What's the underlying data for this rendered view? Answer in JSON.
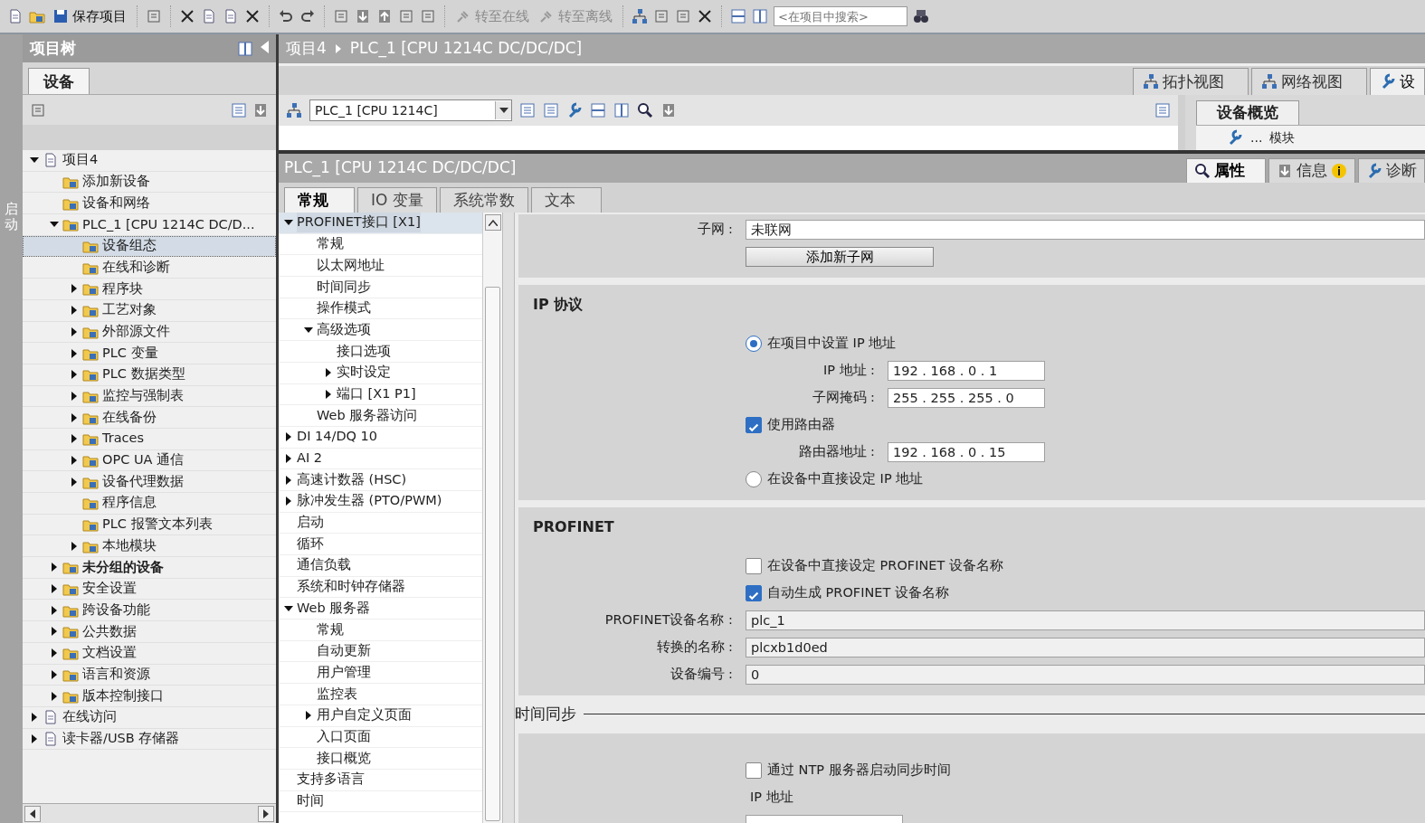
{
  "toolbar": {
    "buttons": [
      {
        "label": "保存项目",
        "disabled": false
      },
      {
        "label": "转至在线",
        "disabled": true
      },
      {
        "label": "转至离线",
        "disabled": true
      }
    ],
    "search": {
      "placeholder": "<在项目中搜索>"
    }
  },
  "side_strip": {
    "label": "启动"
  },
  "project_tree": {
    "title": "项目树",
    "tabs": [
      {
        "label": "设备",
        "selected": true
      }
    ],
    "items": [
      {
        "label": "项目4",
        "expanded": true,
        "selected": false,
        "children": [
          {
            "label": "添加新设备",
            "selected": false
          },
          {
            "label": "设备和网络",
            "selected": false
          },
          {
            "label": "PLC_1 [CPU 1214C DC/D...",
            "expanded": true,
            "selected": false,
            "children": [
              {
                "label": "设备组态",
                "selected": true
              },
              {
                "label": "在线和诊断",
                "selected": false
              },
              {
                "label": "程序块",
                "expanded": false,
                "selected": false
              },
              {
                "label": "工艺对象",
                "expanded": false,
                "selected": false
              },
              {
                "label": "外部源文件",
                "expanded": false,
                "selected": false
              },
              {
                "label": "PLC 变量",
                "expanded": false,
                "selected": false
              },
              {
                "label": "PLC 数据类型",
                "expanded": false,
                "selected": false
              },
              {
                "label": "监控与强制表",
                "expanded": false,
                "selected": false
              },
              {
                "label": "在线备份",
                "expanded": false,
                "selected": false
              },
              {
                "label": "Traces",
                "expanded": false,
                "selected": false
              },
              {
                "label": "OPC UA 通信",
                "expanded": false,
                "selected": false
              },
              {
                "label": "设备代理数据",
                "expanded": false,
                "selected": false
              },
              {
                "label": "程序信息",
                "selected": false
              },
              {
                "label": "PLC 报警文本列表",
                "selected": false
              },
              {
                "label": "本地模块",
                "expanded": false,
                "selected": false
              }
            ]
          },
          {
            "label": "未分组的设备",
            "expanded": false,
            "selected": false,
            "bold": true
          },
          {
            "label": "安全设置",
            "expanded": false,
            "selected": false
          },
          {
            "label": "跨设备功能",
            "expanded": false,
            "selected": false
          },
          {
            "label": "公共数据",
            "expanded": false,
            "selected": false
          },
          {
            "label": "文档设置",
            "expanded": false,
            "selected": false
          },
          {
            "label": "语言和资源",
            "expanded": false,
            "selected": false
          },
          {
            "label": "版本控制接口",
            "expanded": false,
            "selected": false
          }
        ]
      },
      {
        "label": "在线访问",
        "expanded": false,
        "selected": false
      },
      {
        "label": "读卡器/USB 存储器",
        "expanded": false,
        "selected": false
      }
    ]
  },
  "breadcrumb": [
    "项目4",
    "PLC_1 [CPU 1214C DC/DC/DC]"
  ],
  "view_tabs": [
    {
      "label": "拓扑视图",
      "selected": false
    },
    {
      "label": "网络视图",
      "selected": false
    },
    {
      "label": "设",
      "selected": true
    }
  ],
  "device_selector": {
    "value": "PLC_1 [CPU 1214C]"
  },
  "device_overview": {
    "tab": "设备概览",
    "columns": [
      "...",
      "模块"
    ]
  },
  "properties": {
    "title": "PLC_1 [CPU 1214C DC/DC/DC]",
    "side_tabs": [
      {
        "label": "属性",
        "selected": true
      },
      {
        "label": "信息",
        "selected": false
      },
      {
        "label": "诊断",
        "selected": false
      }
    ],
    "tabs": [
      {
        "label": "常规",
        "selected": true
      },
      {
        "label": "IO 变量",
        "selected": false
      },
      {
        "label": "系统常数",
        "selected": false
      },
      {
        "label": "文本",
        "selected": false
      }
    ],
    "nav": [
      {
        "label": "PROFINET接口 [X1]",
        "expanded": true,
        "selected": true,
        "children": [
          {
            "label": "常规",
            "selected": false
          },
          {
            "label": "以太网地址",
            "selected": false
          },
          {
            "label": "时间同步",
            "selected": false
          },
          {
            "label": "操作模式",
            "selected": false
          },
          {
            "label": "高级选项",
            "expanded": true,
            "selected": false,
            "children": [
              {
                "label": "接口选项",
                "selected": false
              },
              {
                "label": "实时设定",
                "expanded": false,
                "selected": false
              },
              {
                "label": "端口 [X1 P1]",
                "expanded": false,
                "selected": false
              }
            ]
          },
          {
            "label": "Web 服务器访问",
            "selected": false
          }
        ]
      },
      {
        "label": "DI 14/DQ 10",
        "expanded": false,
        "selected": false
      },
      {
        "label": "AI 2",
        "expanded": false,
        "selected": false
      },
      {
        "label": "高速计数器 (HSC)",
        "expanded": false,
        "selected": false
      },
      {
        "label": "脉冲发生器 (PTO/PWM)",
        "expanded": false,
        "selected": false
      },
      {
        "label": "启动",
        "selected": false
      },
      {
        "label": "循环",
        "selected": false
      },
      {
        "label": "通信负载",
        "selected": false
      },
      {
        "label": "系统和时钟存储器",
        "selected": false
      },
      {
        "label": "Web 服务器",
        "expanded": true,
        "selected": false,
        "children": [
          {
            "label": "常规",
            "selected": false
          },
          {
            "label": "自动更新",
            "selected": false
          },
          {
            "label": "用户管理",
            "selected": false
          },
          {
            "label": "监控表",
            "selected": false
          },
          {
            "label": "用户自定义页面",
            "expanded": false,
            "selected": false
          },
          {
            "label": "入口页面",
            "selected": false
          },
          {
            "label": "接口概览",
            "selected": false
          }
        ]
      },
      {
        "label": "支持多语言",
        "selected": false
      },
      {
        "label": "时间",
        "selected": false
      }
    ],
    "subnet": {
      "label": "子网 :",
      "value": "未联网",
      "button": "添加新子网"
    },
    "sections": [
      {
        "kind": "box",
        "title": "IP 协议",
        "rows": [
          {
            "kind": "radio",
            "label": "在项目中设置 IP 地址",
            "selected": true
          },
          {
            "kind": "ip",
            "label": "IP 地址 :",
            "value": "192 . 168 . 0 . 1"
          },
          {
            "kind": "ip",
            "label": "子网掩码 :",
            "value": "255 . 255 . 255 . 0"
          },
          {
            "kind": "checkbox",
            "label": "使用路由器",
            "checked": true
          },
          {
            "kind": "ip",
            "label": "路由器地址 :",
            "value": "192 . 168 . 0 . 15"
          },
          {
            "kind": "radio",
            "label": "在设备中直接设定 IP 地址",
            "selected": false
          }
        ]
      },
      {
        "kind": "box",
        "title": "PROFINET",
        "rows": [
          {
            "kind": "checkbox",
            "label": "在设备中直接设定 PROFINET 设备名称",
            "checked": false
          },
          {
            "kind": "checkbox",
            "label": "自动生成 PROFINET 设备名称",
            "checked": true
          },
          {
            "kind": "text",
            "label": "PROFINET设备名称 :",
            "value": "plc_1"
          },
          {
            "kind": "text",
            "label": "转换的名称 :",
            "value": "plcxb1d0ed"
          },
          {
            "kind": "text",
            "label": "设备编号 :",
            "value": "0"
          }
        ]
      },
      {
        "kind": "ruled",
        "title": "时间同步",
        "rows": [
          {
            "kind": "checkbox",
            "label": "通过 NTP 服务器启动同步时间",
            "checked": false
          },
          {
            "kind": "caption",
            "label": "IP 地址"
          }
        ]
      }
    ]
  }
}
